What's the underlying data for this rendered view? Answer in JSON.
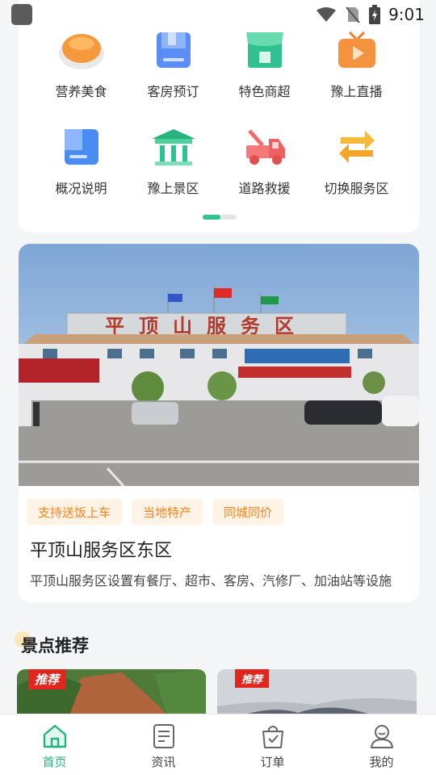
{
  "status_bar": {
    "time": "9:01"
  },
  "grid": {
    "items": [
      {
        "label": "营养美食",
        "icon": "food-bowl-icon"
      },
      {
        "label": "客房预订",
        "icon": "room-booking-icon"
      },
      {
        "label": "特色商超",
        "icon": "shop-icon"
      },
      {
        "label": "豫上直播",
        "icon": "live-tv-icon"
      },
      {
        "label": "概况说明",
        "icon": "overview-book-icon"
      },
      {
        "label": "豫上景区",
        "icon": "scenic-pavilion-icon"
      },
      {
        "label": "道路救援",
        "icon": "tow-truck-icon"
      },
      {
        "label": "切换服务区",
        "icon": "switch-arrows-icon"
      }
    ]
  },
  "service_area": {
    "photo_sign": "平顶山服务区",
    "tags": [
      "支持送饭上车",
      "当地特产",
      "同城同价"
    ],
    "title": "平顶山服务区东区",
    "description": "平顶山服务区设置有餐厅、超市、客房、汽修厂、加油站等设施"
  },
  "recommend": {
    "title": "景点推荐",
    "items": [
      {
        "badge": "推荐"
      },
      {
        "badge": "推荐"
      }
    ]
  },
  "tabbar": {
    "tabs": [
      {
        "label": "首页",
        "icon": "home-icon",
        "active": true
      },
      {
        "label": "资讯",
        "icon": "news-icon",
        "active": false
      },
      {
        "label": "订单",
        "icon": "order-bag-icon",
        "active": false
      },
      {
        "label": "我的",
        "icon": "profile-icon",
        "active": false
      }
    ]
  },
  "colors": {
    "accent": "#26b47e",
    "tag_text": "#f5831f",
    "tag_bg": "#fff3e6",
    "badge_red": "#e0261f"
  }
}
